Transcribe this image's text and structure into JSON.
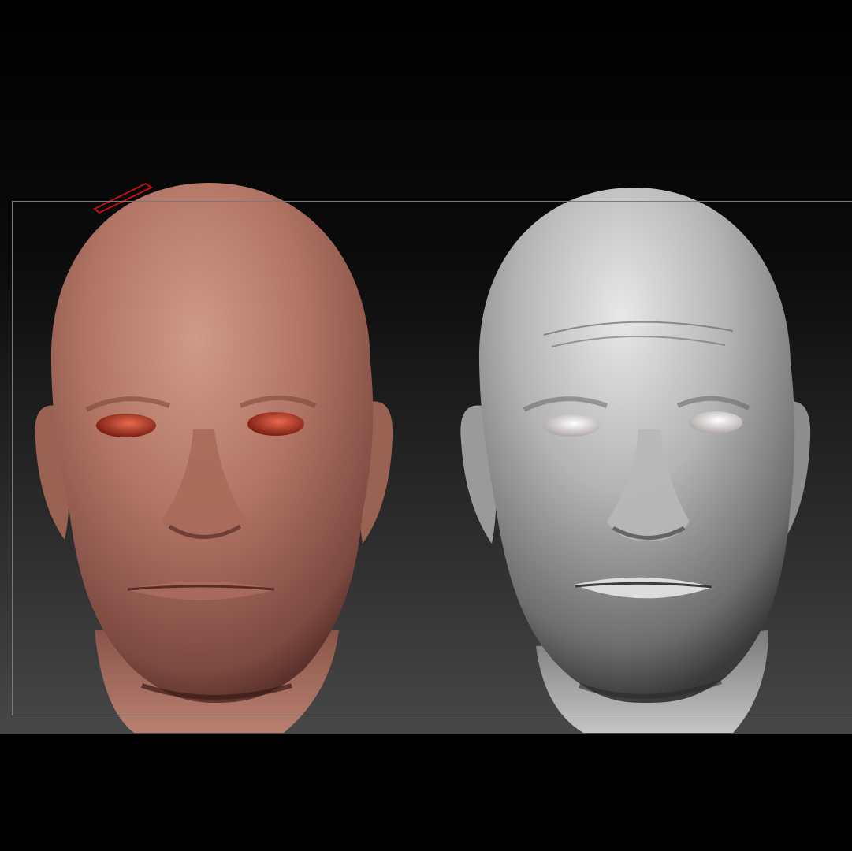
{
  "viewport": {
    "background_top": "#000000",
    "background_bottom": "#474747",
    "frame_color": "#7a7a7a"
  },
  "models": [
    {
      "name": "textured-head",
      "material": "skin-polypaint",
      "base_color": "#b07565",
      "highlight_color": "#d6a08f",
      "shadow_color": "#4a2220",
      "eye_color": "#c24a34"
    },
    {
      "name": "clay-head",
      "material": "matcap-gray",
      "base_color": "#a9a9a9",
      "highlight_color": "#e6e6e6",
      "shadow_color": "#2f2f2f",
      "eye_color": "#f0f0f0"
    }
  ],
  "gizmo": {
    "icon": "transpose-line-icon",
    "color": "#c01010"
  }
}
